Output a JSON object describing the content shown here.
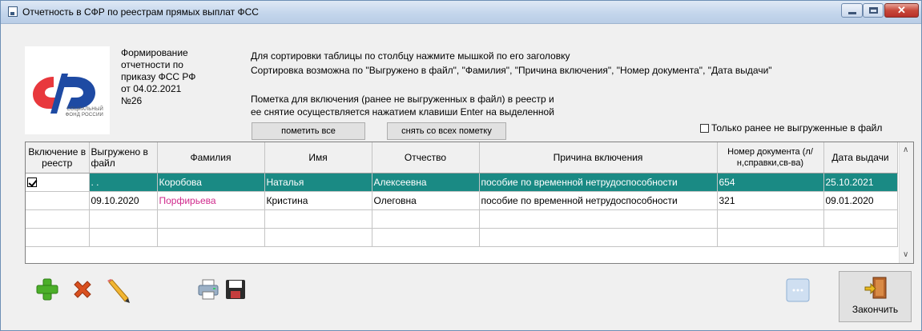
{
  "window": {
    "title": "Отчетность в СФР по реестрам прямых выплат ФСС",
    "close_glyph": "✕"
  },
  "logo": {
    "line1": "СОЦИАЛЬНЫЙ",
    "line2": "ФОНД РОССИИ"
  },
  "order_text": [
    "Формирование",
    "отчетности по",
    "приказу ФСС РФ",
    "от 04.02.2021",
    "№26"
  ],
  "info": {
    "line1": "Для сортировки таблицы по столбцу нажмите мышкой по его заголовку",
    "line2": "Сортировка возможна по \"Выгружено в файл\", \"Фамилия\", \"Причина включения\", \"Номер документа\", \"Дата выдачи\"",
    "line3": "Пометка для включения (ранее не выгруженных в файл) в реестр и",
    "line4": "ее снятие осуществляется нажатием клавиши Enter на выделенной"
  },
  "buttons": {
    "mark_all": "пометить все",
    "unmark_all": "снять со всех пометку",
    "finish": "Закончить"
  },
  "filter": {
    "only_unexported_label": "Только ранее не выгруженные в файл",
    "only_unexported_checked": false
  },
  "table": {
    "columns": [
      "Включение в реестр",
      "Выгружено в файл",
      "Фамилия",
      "Имя",
      "Отчество",
      "Причина включения",
      "Номер документа (л/н,справки,св-ва)",
      "Дата выдачи"
    ],
    "rows": [
      {
        "included": true,
        "exported": " .  .",
        "surname": "Коробова",
        "name": "Наталья",
        "patronymic": "Алексеевна",
        "reason": "пособие по временной нетрудоспособности",
        "doc_number": "654",
        "issue_date": "25.10.2021",
        "selected": true
      },
      {
        "included": false,
        "exported": "09.10.2020",
        "surname": "Порфирьева",
        "name": "Кристина",
        "patronymic": "Олеговна",
        "reason": "пособие по временной нетрудоспособности",
        "doc_number": "321",
        "issue_date": "09.01.2020",
        "selected": false
      }
    ],
    "empty_rows": 2
  },
  "colors": {
    "selected_row": "#1a8a84",
    "surname_highlight": "#d02a8c",
    "accent_title": "#c4d6ec"
  },
  "icons": [
    "add-icon",
    "delete-icon",
    "edit-icon",
    "print-icon",
    "save-icon",
    "message-icon",
    "exit-door-icon",
    "window-minimize-icon",
    "window-maximize-icon",
    "window-close-icon"
  ]
}
